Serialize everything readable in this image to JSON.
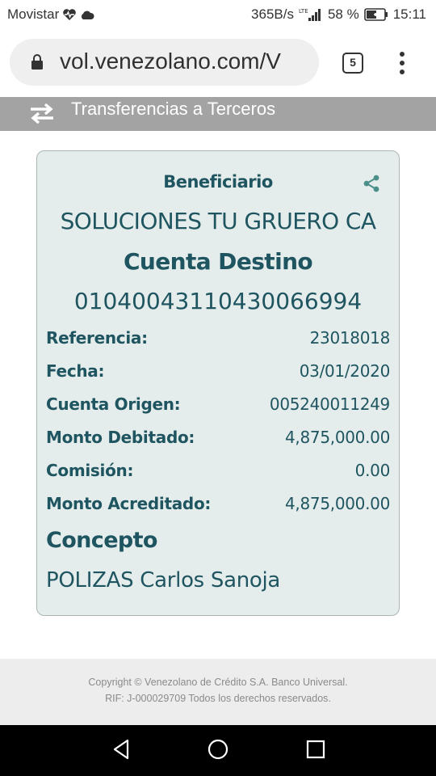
{
  "status_bar": {
    "carrier": "Movistar",
    "speed": "365B/s",
    "battery": "58 %",
    "time": "15:11",
    "icons": [
      "heart-pulse-icon",
      "cloud-icon",
      "lte-signal-icon",
      "battery-charging-icon"
    ]
  },
  "browser": {
    "url": "vol.venezolano.com/V",
    "tab_count": "5"
  },
  "header": {
    "title": "Transferencias a Terceros",
    "icon": "transfer-arrows-icon"
  },
  "receipt": {
    "beneficiary_label": "Beneficiario",
    "beneficiary_name": "SOLUCIONES TU GRUERO CA",
    "destination_label": "Cuenta Destino",
    "destination_account": "01040043110430066994",
    "rows": [
      {
        "label": "Referencia:",
        "value": "23018018"
      },
      {
        "label": "Fecha:",
        "value": "03/01/2020"
      },
      {
        "label": "Cuenta Origen:",
        "value": "005240011249"
      },
      {
        "label": "Monto Debitado:",
        "value": "4,875,000.00"
      },
      {
        "label": "Comisión:",
        "value": "0.00"
      },
      {
        "label": "Monto Acreditado:",
        "value": "4,875,000.00"
      }
    ],
    "concept_label": "Concepto",
    "concept_value": "POLIZAS Carlos Sanoja"
  },
  "footer": {
    "line1": "Copyright © Venezolano de Crédito S.A. Banco Universal.",
    "line2": "RIF: J-000029709 Todos los derechos reservados."
  },
  "colors": {
    "card_text": "#1f5560",
    "card_bg": "#e5edec",
    "header_bg": "#a3a3a3",
    "share_icon": "#4a8f8a"
  }
}
